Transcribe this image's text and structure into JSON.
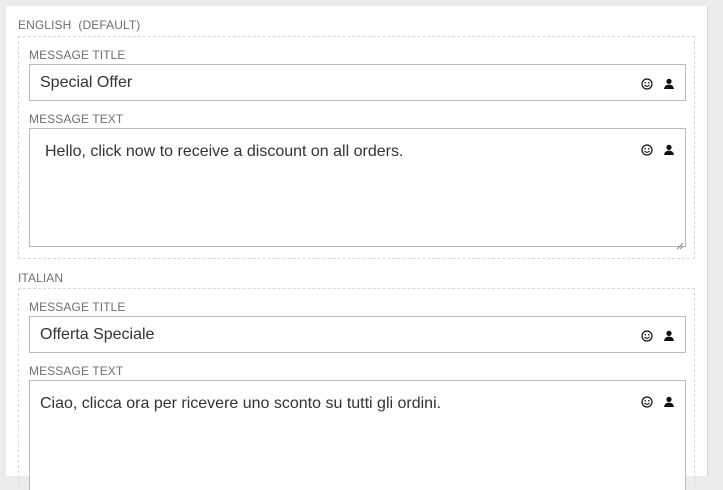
{
  "sections": [
    {
      "language": "ENGLISH",
      "tag": "(DEFAULT)",
      "title_label": "MESSAGE TITLE",
      "title_value": "Special Offer",
      "text_label": "MESSAGE TEXT",
      "text_value": "Hello, click now to receive a discount on all orders."
    },
    {
      "language": "ITALIAN",
      "tag": "",
      "title_label": "MESSAGE TITLE",
      "title_value": "Offerta Speciale",
      "text_label": "MESSAGE TEXT",
      "text_value": "Ciao, clicca ora per ricevere uno sconto su tutti gli ordini."
    }
  ],
  "icons": {
    "emoji": "smiley-icon",
    "personalize": "user-icon"
  }
}
